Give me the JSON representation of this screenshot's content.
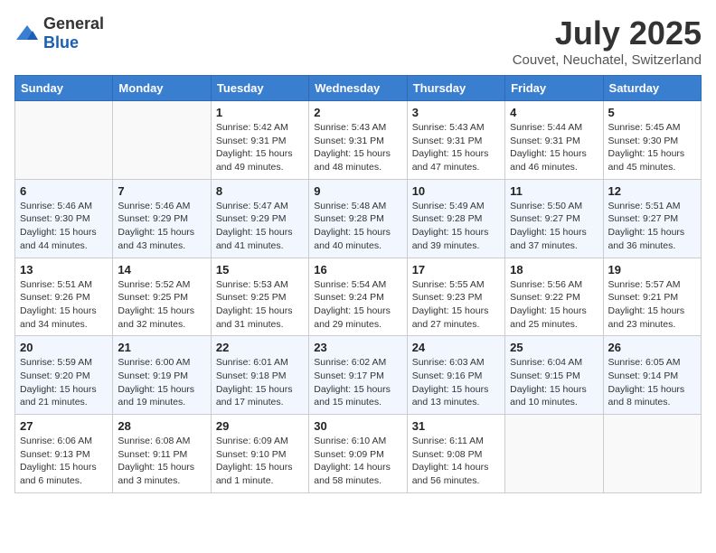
{
  "header": {
    "logo_general": "General",
    "logo_blue": "Blue",
    "month": "July 2025",
    "location": "Couvet, Neuchatel, Switzerland"
  },
  "days_of_week": [
    "Sunday",
    "Monday",
    "Tuesday",
    "Wednesday",
    "Thursday",
    "Friday",
    "Saturday"
  ],
  "weeks": [
    [
      {
        "day": "",
        "sunrise": "",
        "sunset": "",
        "daylight": ""
      },
      {
        "day": "",
        "sunrise": "",
        "sunset": "",
        "daylight": ""
      },
      {
        "day": "1",
        "sunrise": "Sunrise: 5:42 AM",
        "sunset": "Sunset: 9:31 PM",
        "daylight": "Daylight: 15 hours and 49 minutes."
      },
      {
        "day": "2",
        "sunrise": "Sunrise: 5:43 AM",
        "sunset": "Sunset: 9:31 PM",
        "daylight": "Daylight: 15 hours and 48 minutes."
      },
      {
        "day": "3",
        "sunrise": "Sunrise: 5:43 AM",
        "sunset": "Sunset: 9:31 PM",
        "daylight": "Daylight: 15 hours and 47 minutes."
      },
      {
        "day": "4",
        "sunrise": "Sunrise: 5:44 AM",
        "sunset": "Sunset: 9:31 PM",
        "daylight": "Daylight: 15 hours and 46 minutes."
      },
      {
        "day": "5",
        "sunrise": "Sunrise: 5:45 AM",
        "sunset": "Sunset: 9:30 PM",
        "daylight": "Daylight: 15 hours and 45 minutes."
      }
    ],
    [
      {
        "day": "6",
        "sunrise": "Sunrise: 5:46 AM",
        "sunset": "Sunset: 9:30 PM",
        "daylight": "Daylight: 15 hours and 44 minutes."
      },
      {
        "day": "7",
        "sunrise": "Sunrise: 5:46 AM",
        "sunset": "Sunset: 9:29 PM",
        "daylight": "Daylight: 15 hours and 43 minutes."
      },
      {
        "day": "8",
        "sunrise": "Sunrise: 5:47 AM",
        "sunset": "Sunset: 9:29 PM",
        "daylight": "Daylight: 15 hours and 41 minutes."
      },
      {
        "day": "9",
        "sunrise": "Sunrise: 5:48 AM",
        "sunset": "Sunset: 9:28 PM",
        "daylight": "Daylight: 15 hours and 40 minutes."
      },
      {
        "day": "10",
        "sunrise": "Sunrise: 5:49 AM",
        "sunset": "Sunset: 9:28 PM",
        "daylight": "Daylight: 15 hours and 39 minutes."
      },
      {
        "day": "11",
        "sunrise": "Sunrise: 5:50 AM",
        "sunset": "Sunset: 9:27 PM",
        "daylight": "Daylight: 15 hours and 37 minutes."
      },
      {
        "day": "12",
        "sunrise": "Sunrise: 5:51 AM",
        "sunset": "Sunset: 9:27 PM",
        "daylight": "Daylight: 15 hours and 36 minutes."
      }
    ],
    [
      {
        "day": "13",
        "sunrise": "Sunrise: 5:51 AM",
        "sunset": "Sunset: 9:26 PM",
        "daylight": "Daylight: 15 hours and 34 minutes."
      },
      {
        "day": "14",
        "sunrise": "Sunrise: 5:52 AM",
        "sunset": "Sunset: 9:25 PM",
        "daylight": "Daylight: 15 hours and 32 minutes."
      },
      {
        "day": "15",
        "sunrise": "Sunrise: 5:53 AM",
        "sunset": "Sunset: 9:25 PM",
        "daylight": "Daylight: 15 hours and 31 minutes."
      },
      {
        "day": "16",
        "sunrise": "Sunrise: 5:54 AM",
        "sunset": "Sunset: 9:24 PM",
        "daylight": "Daylight: 15 hours and 29 minutes."
      },
      {
        "day": "17",
        "sunrise": "Sunrise: 5:55 AM",
        "sunset": "Sunset: 9:23 PM",
        "daylight": "Daylight: 15 hours and 27 minutes."
      },
      {
        "day": "18",
        "sunrise": "Sunrise: 5:56 AM",
        "sunset": "Sunset: 9:22 PM",
        "daylight": "Daylight: 15 hours and 25 minutes."
      },
      {
        "day": "19",
        "sunrise": "Sunrise: 5:57 AM",
        "sunset": "Sunset: 9:21 PM",
        "daylight": "Daylight: 15 hours and 23 minutes."
      }
    ],
    [
      {
        "day": "20",
        "sunrise": "Sunrise: 5:59 AM",
        "sunset": "Sunset: 9:20 PM",
        "daylight": "Daylight: 15 hours and 21 minutes."
      },
      {
        "day": "21",
        "sunrise": "Sunrise: 6:00 AM",
        "sunset": "Sunset: 9:19 PM",
        "daylight": "Daylight: 15 hours and 19 minutes."
      },
      {
        "day": "22",
        "sunrise": "Sunrise: 6:01 AM",
        "sunset": "Sunset: 9:18 PM",
        "daylight": "Daylight: 15 hours and 17 minutes."
      },
      {
        "day": "23",
        "sunrise": "Sunrise: 6:02 AM",
        "sunset": "Sunset: 9:17 PM",
        "daylight": "Daylight: 15 hours and 15 minutes."
      },
      {
        "day": "24",
        "sunrise": "Sunrise: 6:03 AM",
        "sunset": "Sunset: 9:16 PM",
        "daylight": "Daylight: 15 hours and 13 minutes."
      },
      {
        "day": "25",
        "sunrise": "Sunrise: 6:04 AM",
        "sunset": "Sunset: 9:15 PM",
        "daylight": "Daylight: 15 hours and 10 minutes."
      },
      {
        "day": "26",
        "sunrise": "Sunrise: 6:05 AM",
        "sunset": "Sunset: 9:14 PM",
        "daylight": "Daylight: 15 hours and 8 minutes."
      }
    ],
    [
      {
        "day": "27",
        "sunrise": "Sunrise: 6:06 AM",
        "sunset": "Sunset: 9:13 PM",
        "daylight": "Daylight: 15 hours and 6 minutes."
      },
      {
        "day": "28",
        "sunrise": "Sunrise: 6:08 AM",
        "sunset": "Sunset: 9:11 PM",
        "daylight": "Daylight: 15 hours and 3 minutes."
      },
      {
        "day": "29",
        "sunrise": "Sunrise: 6:09 AM",
        "sunset": "Sunset: 9:10 PM",
        "daylight": "Daylight: 15 hours and 1 minute."
      },
      {
        "day": "30",
        "sunrise": "Sunrise: 6:10 AM",
        "sunset": "Sunset: 9:09 PM",
        "daylight": "Daylight: 14 hours and 58 minutes."
      },
      {
        "day": "31",
        "sunrise": "Sunrise: 6:11 AM",
        "sunset": "Sunset: 9:08 PM",
        "daylight": "Daylight: 14 hours and 56 minutes."
      },
      {
        "day": "",
        "sunrise": "",
        "sunset": "",
        "daylight": ""
      },
      {
        "day": "",
        "sunrise": "",
        "sunset": "",
        "daylight": ""
      }
    ]
  ]
}
